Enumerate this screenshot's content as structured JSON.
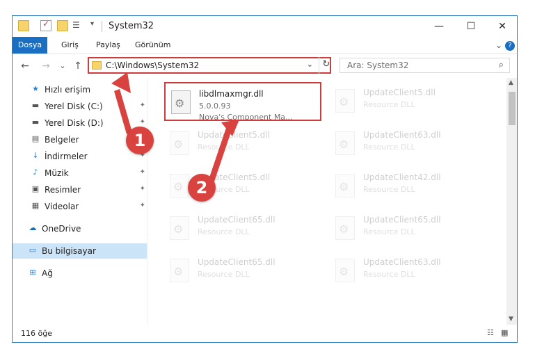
{
  "titlebar": {
    "title": "System32",
    "minimize": "—",
    "maximize": "☐",
    "close": "✕"
  },
  "ribbon": {
    "tabs": [
      "Dosya",
      "Giriş",
      "Paylaş",
      "Görünüm"
    ],
    "expand": "⌄",
    "help": "?"
  },
  "nav": {
    "back": "←",
    "forward": "→",
    "recent": "⌄",
    "up": "↑",
    "refresh": "↻",
    "dropdown": "⌄"
  },
  "address": {
    "path": "C:\\Windows\\System32"
  },
  "search": {
    "placeholder": "Ara: System32",
    "icon": "⌕"
  },
  "sidebar": {
    "items": [
      {
        "label": "Hızlı erişim",
        "icon": "star-icon",
        "glyph": "★",
        "pinned": false
      },
      {
        "label": "Yerel Disk (C:)",
        "icon": "drive-icon",
        "glyph": "▬",
        "pinned": true
      },
      {
        "label": "Yerel Disk (D:)",
        "icon": "drive-icon",
        "glyph": "▬",
        "pinned": true
      },
      {
        "label": "Belgeler",
        "icon": "document-icon",
        "glyph": "▤",
        "pinned": true
      },
      {
        "label": "İndirmeler",
        "icon": "download-icon",
        "glyph": "↓",
        "pinned": true
      },
      {
        "label": "Müzik",
        "icon": "music-icon",
        "glyph": "♪",
        "pinned": true
      },
      {
        "label": "Resimler",
        "icon": "pictures-icon",
        "glyph": "▣",
        "pinned": true
      },
      {
        "label": "Videolar",
        "icon": "video-icon",
        "glyph": "▦",
        "pinned": true
      },
      {
        "label": "OneDrive",
        "icon": "cloud-icon",
        "glyph": "☁",
        "pinned": false
      },
      {
        "label": "Bu bilgisayar",
        "icon": "computer-icon",
        "glyph": "▭",
        "pinned": false
      },
      {
        "label": "Ağ",
        "icon": "network-icon",
        "glyph": "⊞",
        "pinned": false
      }
    ],
    "pin_glyph": "✦"
  },
  "files": [
    {
      "name": "libdlmaxmgr.dll",
      "line1": "5.0.0.93",
      "line2": "Nova's Component Ma...",
      "highlight": true
    },
    {
      "name": "UpdateClient5.dll",
      "line1": "Resource DLL",
      "line2": ""
    },
    {
      "name": "UpdateClient5.dll",
      "line1": "Resource DLL",
      "line2": ""
    },
    {
      "name": "UpdateClient63.dll",
      "line1": "Resource DLL",
      "line2": ""
    },
    {
      "name": "UpdateClient5.dll",
      "line1": "Resource DLL",
      "line2": ""
    },
    {
      "name": "UpdateClient42.dll",
      "line1": "Resource DLL",
      "line2": ""
    },
    {
      "name": "UpdateClient65.dll",
      "line1": "Resource DLL",
      "line2": ""
    },
    {
      "name": "UpdateClient65.dll",
      "line1": "Resource DLL",
      "line2": ""
    },
    {
      "name": "UpdateClient65.dll",
      "line1": "Resource DLL",
      "line2": ""
    },
    {
      "name": "UpdateClient63.dll",
      "line1": "Resource DLL",
      "line2": ""
    }
  ],
  "status": {
    "count": "116 öğe"
  },
  "annotations": {
    "badge1": "1",
    "badge2": "2",
    "color": "#d8423f"
  }
}
